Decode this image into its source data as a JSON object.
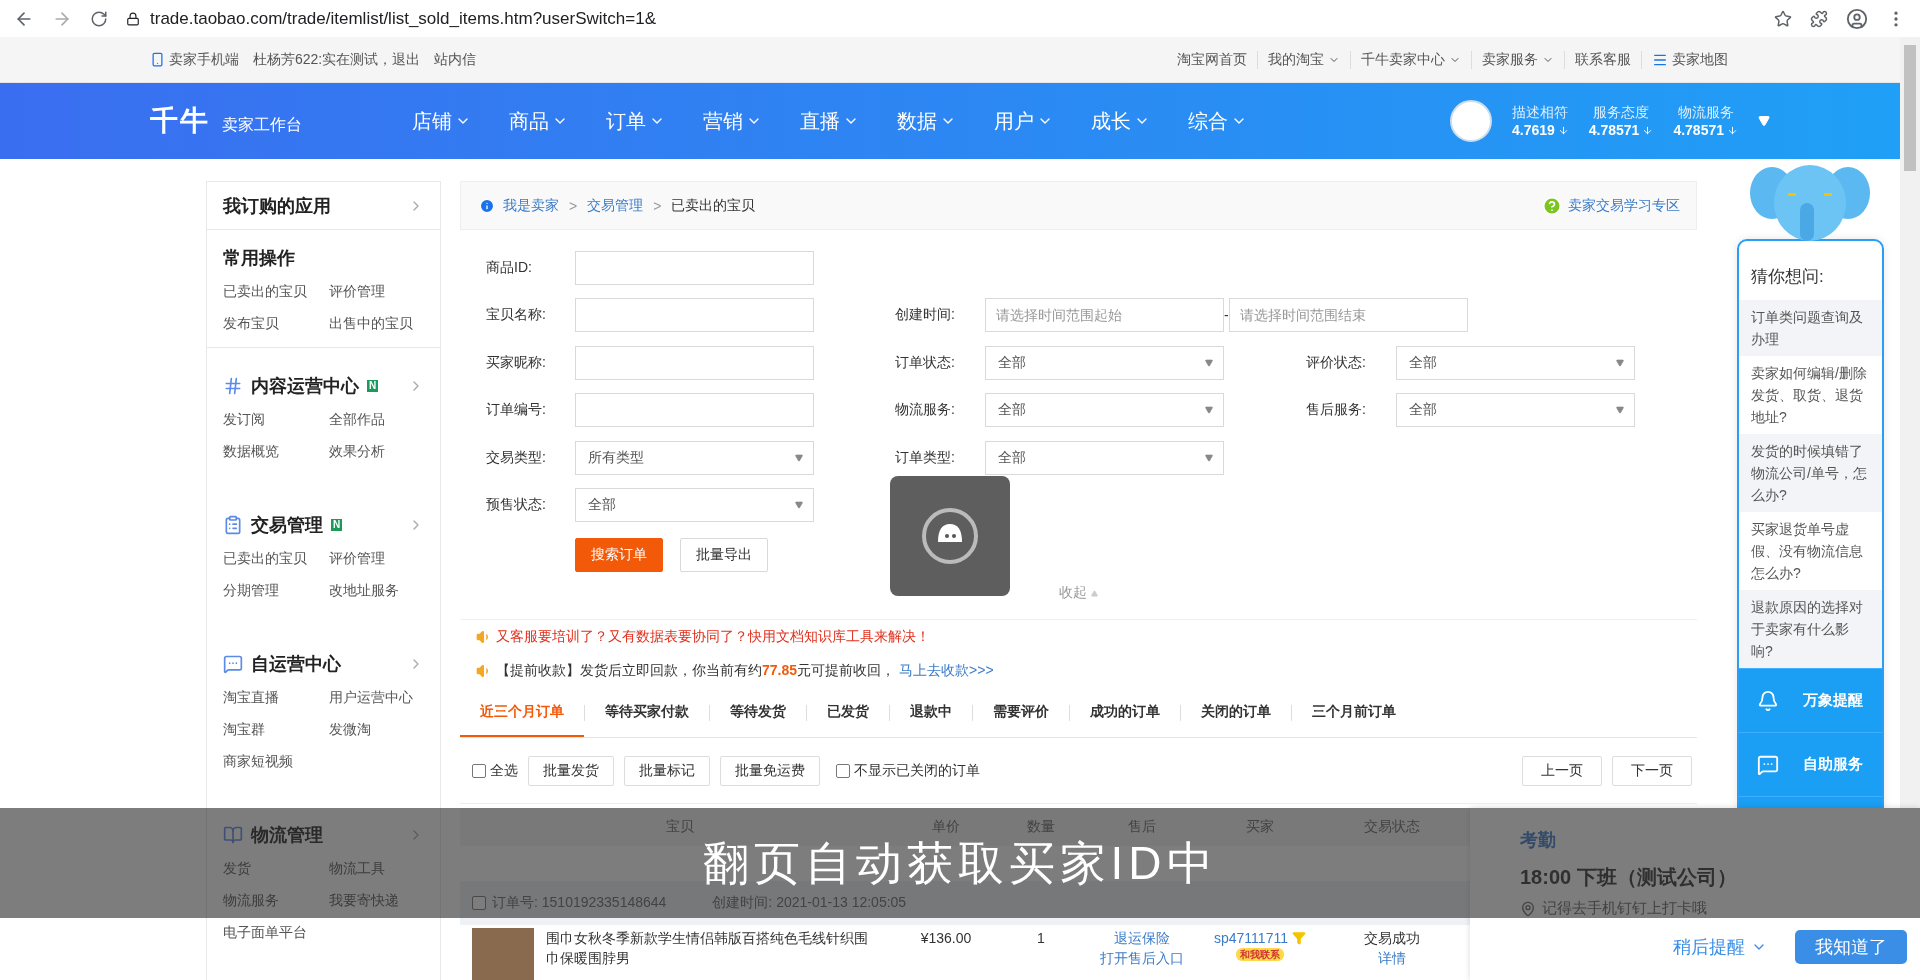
{
  "browser": {
    "url": "trade.taobao.com/trade/itemlist/list_sold_items.htm?userSwitch=1&"
  },
  "top_bar": {
    "left": [
      {
        "kind": "phone",
        "label": "卖家手机端"
      },
      {
        "kind": "text",
        "label": "杜杨芳622:实在测试，退出"
      },
      {
        "kind": "text",
        "label": "站内信"
      }
    ],
    "right": [
      {
        "kind": "link",
        "label": "淘宝网首页"
      },
      {
        "kind": "dropdown",
        "label": "我的淘宝"
      },
      {
        "kind": "dropdown",
        "label": "千牛卖家中心"
      },
      {
        "kind": "dropdown",
        "label": "卖家服务"
      },
      {
        "kind": "link",
        "label": "联系客服"
      },
      {
        "kind": "menu",
        "label": "卖家地图"
      }
    ]
  },
  "header": {
    "logo": "千牛",
    "subtitle": "卖家工作台",
    "nav": [
      "店铺",
      "商品",
      "订单",
      "营销",
      "直播",
      "数据",
      "用户",
      "成长",
      "综合"
    ],
    "ratings": [
      {
        "label": "描述相符",
        "value": "4.7619"
      },
      {
        "label": "服务态度",
        "value": "4.78571"
      },
      {
        "label": "物流服务",
        "value": "4.78571"
      }
    ]
  },
  "sidebar": {
    "sections": [
      {
        "kind": "apps",
        "title": "我订购的应用"
      },
      {
        "kind": "plain",
        "title": "常用操作",
        "items": [
          "已卖出的宝贝",
          "评价管理",
          "发布宝贝",
          "出售中的宝贝"
        ]
      },
      {
        "kind": "hash",
        "title": "内容运营中心",
        "badge": "N",
        "items": [
          "发订阅",
          "全部作品",
          "数据概览",
          "效果分析"
        ]
      },
      {
        "kind": "clipboard",
        "title": "交易管理",
        "badge": "N",
        "items": [
          "已卖出的宝贝",
          "评价管理",
          "分期管理",
          "改地址服务"
        ]
      },
      {
        "kind": "chat",
        "title": "自运营中心",
        "items": [
          "淘宝直播",
          "用户运营中心",
          "淘宝群",
          "发微淘",
          "商家短视频"
        ]
      },
      {
        "kind": "book",
        "title": "物流管理",
        "items": [
          "发货",
          "物流工具",
          "物流服务",
          "我要寄快递",
          "电子面单平台"
        ]
      }
    ]
  },
  "breadcrumb": {
    "items": [
      "我是卖家",
      "交易管理",
      "已卖出的宝贝"
    ],
    "separator": ">",
    "help": "卖家交易学习专区"
  },
  "form": {
    "rows": [
      [
        {
          "kind": "text",
          "label": "商品ID:"
        }
      ],
      [
        {
          "kind": "text",
          "label": "宝贝名称:"
        },
        {
          "kind": "range",
          "label": "创建时间:",
          "placeholder_from": "请选择时间范围起始",
          "separator": "-",
          "placeholder_to": "请选择时间范围结束"
        }
      ],
      [
        {
          "kind": "text",
          "label": "买家昵称:"
        },
        {
          "kind": "select",
          "label": "订单状态:",
          "value": "全部"
        },
        {
          "kind": "select",
          "label": "评价状态:",
          "value": "全部"
        }
      ],
      [
        {
          "kind": "text",
          "label": "订单编号:"
        },
        {
          "kind": "select",
          "label": "物流服务:",
          "value": "全部"
        },
        {
          "kind": "select",
          "label": "售后服务:",
          "value": "全部"
        }
      ],
      [
        {
          "kind": "select",
          "label": "交易类型:",
          "value": "所有类型"
        },
        {
          "kind": "select",
          "label": "订单类型:",
          "value": "全部"
        }
      ],
      [
        {
          "kind": "select",
          "label": "预售状态:",
          "value": "全部"
        }
      ]
    ],
    "buttons": [
      {
        "label": "搜索订单",
        "primary": true
      },
      {
        "label": "批量导出",
        "primary": false
      }
    ],
    "collapse": "收起"
  },
  "notices": [
    {
      "kind": "alert",
      "text": "又客服要培训了？又有数据表要协同了？快用文档知识库工具来解决！"
    },
    {
      "kind": "payout",
      "text": "【提前收款】发货后立即回款，你当前有约**77.85**元可提前收回，",
      "link": "马上去收款>>>"
    }
  ],
  "tabs": [
    {
      "label": "近三个月订单",
      "selected": true
    },
    {
      "label": "等待买家付款",
      "selected": false
    },
    {
      "label": "等待发货",
      "selected": false
    },
    {
      "label": "已发货",
      "selected": false
    },
    {
      "label": "退款中",
      "selected": false
    },
    {
      "label": "需要评价",
      "selected": false
    },
    {
      "label": "成功的订单",
      "selected": false
    },
    {
      "label": "关闭的订单",
      "selected": false
    },
    {
      "label": "三个月前订单",
      "selected": false
    }
  ],
  "toolbar": {
    "select_all": {
      "label": "全选",
      "checked": false
    },
    "actions": [
      "批量发货",
      "批量标记",
      "批量免运费"
    ],
    "hide_closed": {
      "label": "不显示已关闭的订单",
      "checked": false
    },
    "pager": [
      "上一页",
      "下一页"
    ]
  },
  "table": {
    "columns": [
      "宝贝",
      "单价",
      "数量",
      "售后",
      "买家",
      "交易状态"
    ],
    "orders": [
      {
        "checked": false,
        "order_no": "订单号: 1510192335148644",
        "created": "创建时间: 2021-01-13 12:05:05",
        "items": [
          {
            "title": "围巾女秋冬季新款学生情侣韩版百搭纯色毛线针织围巾保暖围脖男",
            "price": "¥136.00",
            "qty": "1",
            "after_sale": [
              "退运保险",
              "打开售后入口"
            ],
            "buyer": "sp47111711",
            "contact": "和我联系",
            "status": "交易成功",
            "detail": "详情"
          }
        ]
      }
    ]
  },
  "help_panel": {
    "title": "猜你想问:",
    "questions": [
      "订单类问题查询及办理",
      "卖家如何编辑/删除发货、取货、退货地址?",
      "发货的时候填错了物流公司/单号，怎么办?",
      "买家退货单号虚假、没有物流信息怎么办?",
      "退款原因的选择对于卖家有什么影响?"
    ],
    "actions": [
      {
        "kind": "bell",
        "label": "万象提醒"
      },
      {
        "kind": "chat",
        "label": "自助服务"
      }
    ]
  },
  "caption": "翻页自动获取买家ID中",
  "notification": {
    "title": "考勤",
    "heading": "18:00 下班（测试公司）",
    "note": "记得去手机钉钉上打卡哦",
    "later": "稍后提醒",
    "ok": "我知道了"
  }
}
